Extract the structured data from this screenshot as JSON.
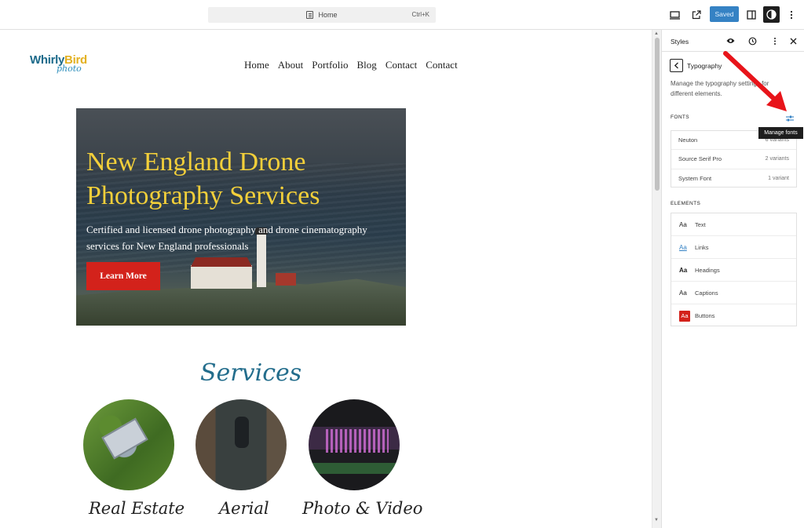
{
  "toolbar": {
    "command_label": "Home",
    "command_shortcut": "Ctrl+K",
    "saved_label": "Saved",
    "icons": [
      "desktop-preview-icon",
      "external-link-icon",
      "sidebar-toggle-icon",
      "contrast-icon",
      "more-vertical-icon",
      "document-icon"
    ]
  },
  "site": {
    "logo_line1_a": "Whirly",
    "logo_line1_b": "Bird",
    "logo_line2": "photo",
    "nav": [
      "Home",
      "About",
      "Portfolio",
      "Blog",
      "Contact",
      "Contact"
    ],
    "hero": {
      "headline": "New England Drone Photography Services",
      "subheadline": "Certified and licensed drone photography and drone cinematography services for New England professionals",
      "cta_label": "Learn More"
    },
    "services_title": "Services",
    "services": [
      {
        "label": "Real Estate"
      },
      {
        "label": "Aerial"
      },
      {
        "label": "Photo & Video"
      }
    ]
  },
  "sidebar": {
    "title": "Styles",
    "panel_title": "Typography",
    "panel_description": "Manage the typography settings for different elements.",
    "fonts_label": "FONTS",
    "manage_fonts_tooltip": "Manage fonts",
    "fonts": [
      {
        "name": "Neuton",
        "variants": "6 variants"
      },
      {
        "name": "Source Serif Pro",
        "variants": "2 variants"
      },
      {
        "name": "System Font",
        "variants": "1 variant"
      }
    ],
    "elements_label": "ELEMENTS",
    "aa_glyph": "Aa",
    "elements": [
      {
        "label": "Text"
      },
      {
        "label": "Links"
      },
      {
        "label": "Headings"
      },
      {
        "label": "Captions"
      },
      {
        "label": "Buttons"
      }
    ]
  },
  "colors": {
    "accent_blue": "#3582c4",
    "hero_headline": "#f2cf3a",
    "cta_red": "#d3221b",
    "services_title": "#236d8c",
    "annotation_arrow": "#e8141a"
  }
}
